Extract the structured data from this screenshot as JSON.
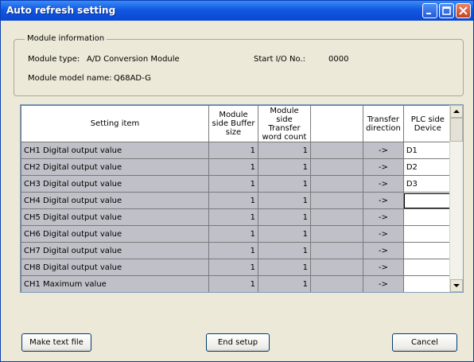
{
  "window": {
    "title": "Auto refresh setting"
  },
  "module_info": {
    "group_label": "Module information",
    "type_label": "Module type:",
    "type_value": "A/D Conversion Module",
    "start_io_label": "Start I/O No.:",
    "start_io_value": "0000",
    "model_label": "Module model name:",
    "model_value": "Q68AD-G"
  },
  "table": {
    "headers": [
      "Setting item",
      "Module side Buffer size",
      "Module side Transfer word count",
      "",
      "Transfer direction",
      "PLC side Device"
    ],
    "rows": [
      {
        "item": "CH1 Digital output value",
        "buffer": "1",
        "count": "1",
        "dir": "->",
        "device": "D1"
      },
      {
        "item": "CH2 Digital output value",
        "buffer": "1",
        "count": "1",
        "dir": "->",
        "device": "D2"
      },
      {
        "item": "CH3 Digital output value",
        "buffer": "1",
        "count": "1",
        "dir": "->",
        "device": "D3"
      },
      {
        "item": "CH4 Digital output value",
        "buffer": "1",
        "count": "1",
        "dir": "->",
        "device": ""
      },
      {
        "item": "CH5 Digital output value",
        "buffer": "1",
        "count": "1",
        "dir": "->",
        "device": ""
      },
      {
        "item": "CH6 Digital output value",
        "buffer": "1",
        "count": "1",
        "dir": "->",
        "device": ""
      },
      {
        "item": "CH7 Digital output value",
        "buffer": "1",
        "count": "1",
        "dir": "->",
        "device": ""
      },
      {
        "item": "CH8 Digital output value",
        "buffer": "1",
        "count": "1",
        "dir": "->",
        "device": ""
      },
      {
        "item": "CH1 Maximum value",
        "buffer": "1",
        "count": "1",
        "dir": "->",
        "device": ""
      }
    ]
  },
  "buttons": {
    "make_text_file": "Make text file",
    "end_setup": "End setup",
    "cancel": "Cancel"
  },
  "icons": {
    "minimize": "minimize-icon",
    "maximize": "maximize-icon",
    "close": "close-icon",
    "scroll_up": "arrow-up-icon",
    "scroll_down": "arrow-down-icon"
  },
  "colors": {
    "title_bar": "#0a47d2",
    "dialog_bg": "#ece9d8",
    "readonly_cell": "#c0c0c8"
  }
}
